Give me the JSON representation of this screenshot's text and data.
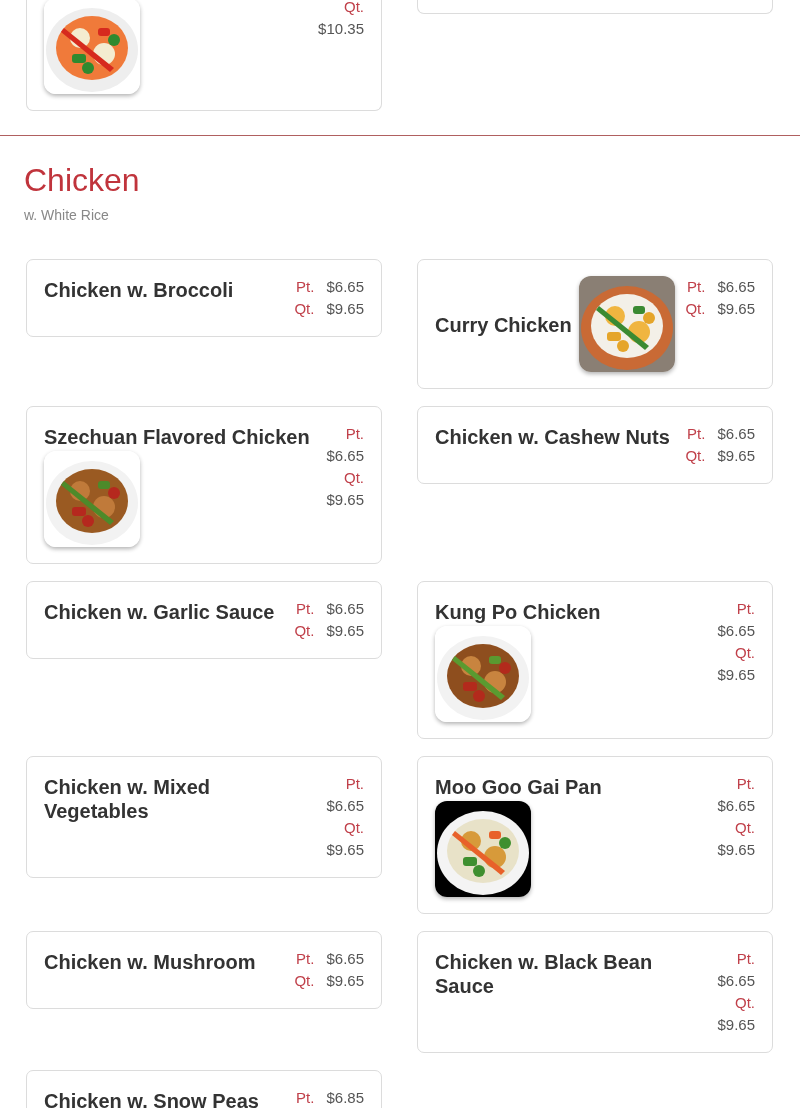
{
  "top_cards": [
    {
      "kind": "image-below",
      "prices_stacked": true,
      "prices": [
        {
          "size": "Qt.",
          "price": "$10.35"
        }
      ]
    },
    {
      "kind": "empty"
    }
  ],
  "section": {
    "title": "Chicken",
    "subtitle": "w. White Rice",
    "items": [
      {
        "name": "Chicken w. Broccoli",
        "kind": "plain",
        "prices_stacked": false,
        "prices": [
          {
            "size": "Pt.",
            "price": "$6.65"
          },
          {
            "size": "Qt.",
            "price": "$9.65"
          }
        ]
      },
      {
        "name": "Curry Chicken",
        "kind": "image-side",
        "prices_stacked": false,
        "prices": [
          {
            "size": "Pt.",
            "price": "$6.65"
          },
          {
            "size": "Qt.",
            "price": "$9.65"
          }
        ]
      },
      {
        "name": "Szechuan Flavored Chicken",
        "kind": "image-below",
        "prices_stacked": true,
        "prices": [
          {
            "size": "Pt.",
            "price": "$6.65"
          },
          {
            "size": "Qt.",
            "price": "$9.65"
          }
        ]
      },
      {
        "name": "Chicken w. Cashew Nuts",
        "kind": "plain",
        "prices_stacked": false,
        "prices": [
          {
            "size": "Pt.",
            "price": "$6.65"
          },
          {
            "size": "Qt.",
            "price": "$9.65"
          }
        ]
      },
      {
        "name": "Chicken w. Garlic Sauce",
        "kind": "plain",
        "prices_stacked": false,
        "prices": [
          {
            "size": "Pt.",
            "price": "$6.65"
          },
          {
            "size": "Qt.",
            "price": "$9.65"
          }
        ]
      },
      {
        "name": "Kung Po Chicken",
        "kind": "image-below",
        "prices_stacked": true,
        "prices": [
          {
            "size": "Pt.",
            "price": "$6.65"
          },
          {
            "size": "Qt.",
            "price": "$9.65"
          }
        ]
      },
      {
        "name": "Chicken w. Mixed Vegetables",
        "kind": "plain",
        "prices_stacked": true,
        "prices": [
          {
            "size": "Pt.",
            "price": "$6.65"
          },
          {
            "size": "Qt.",
            "price": "$9.65"
          }
        ]
      },
      {
        "name": "Moo Goo Gai Pan",
        "kind": "image-below",
        "prices_stacked": true,
        "prices": [
          {
            "size": "Pt.",
            "price": "$6.65"
          },
          {
            "size": "Qt.",
            "price": "$9.65"
          }
        ]
      },
      {
        "name": "Chicken w. Mushroom",
        "kind": "plain",
        "prices_stacked": false,
        "prices": [
          {
            "size": "Pt.",
            "price": "$6.65"
          },
          {
            "size": "Qt.",
            "price": "$9.65"
          }
        ]
      },
      {
        "name": "Chicken w. Black Bean Sauce",
        "kind": "plain",
        "prices_stacked": true,
        "prices": [
          {
            "size": "Pt.",
            "price": "$6.65"
          },
          {
            "size": "Qt.",
            "price": "$9.65"
          }
        ]
      },
      {
        "name": "Chicken w. Snow Peas",
        "kind": "plain",
        "prices_stacked": false,
        "prices": [
          {
            "size": "Pt.",
            "price": "$6.85"
          }
        ]
      }
    ]
  }
}
